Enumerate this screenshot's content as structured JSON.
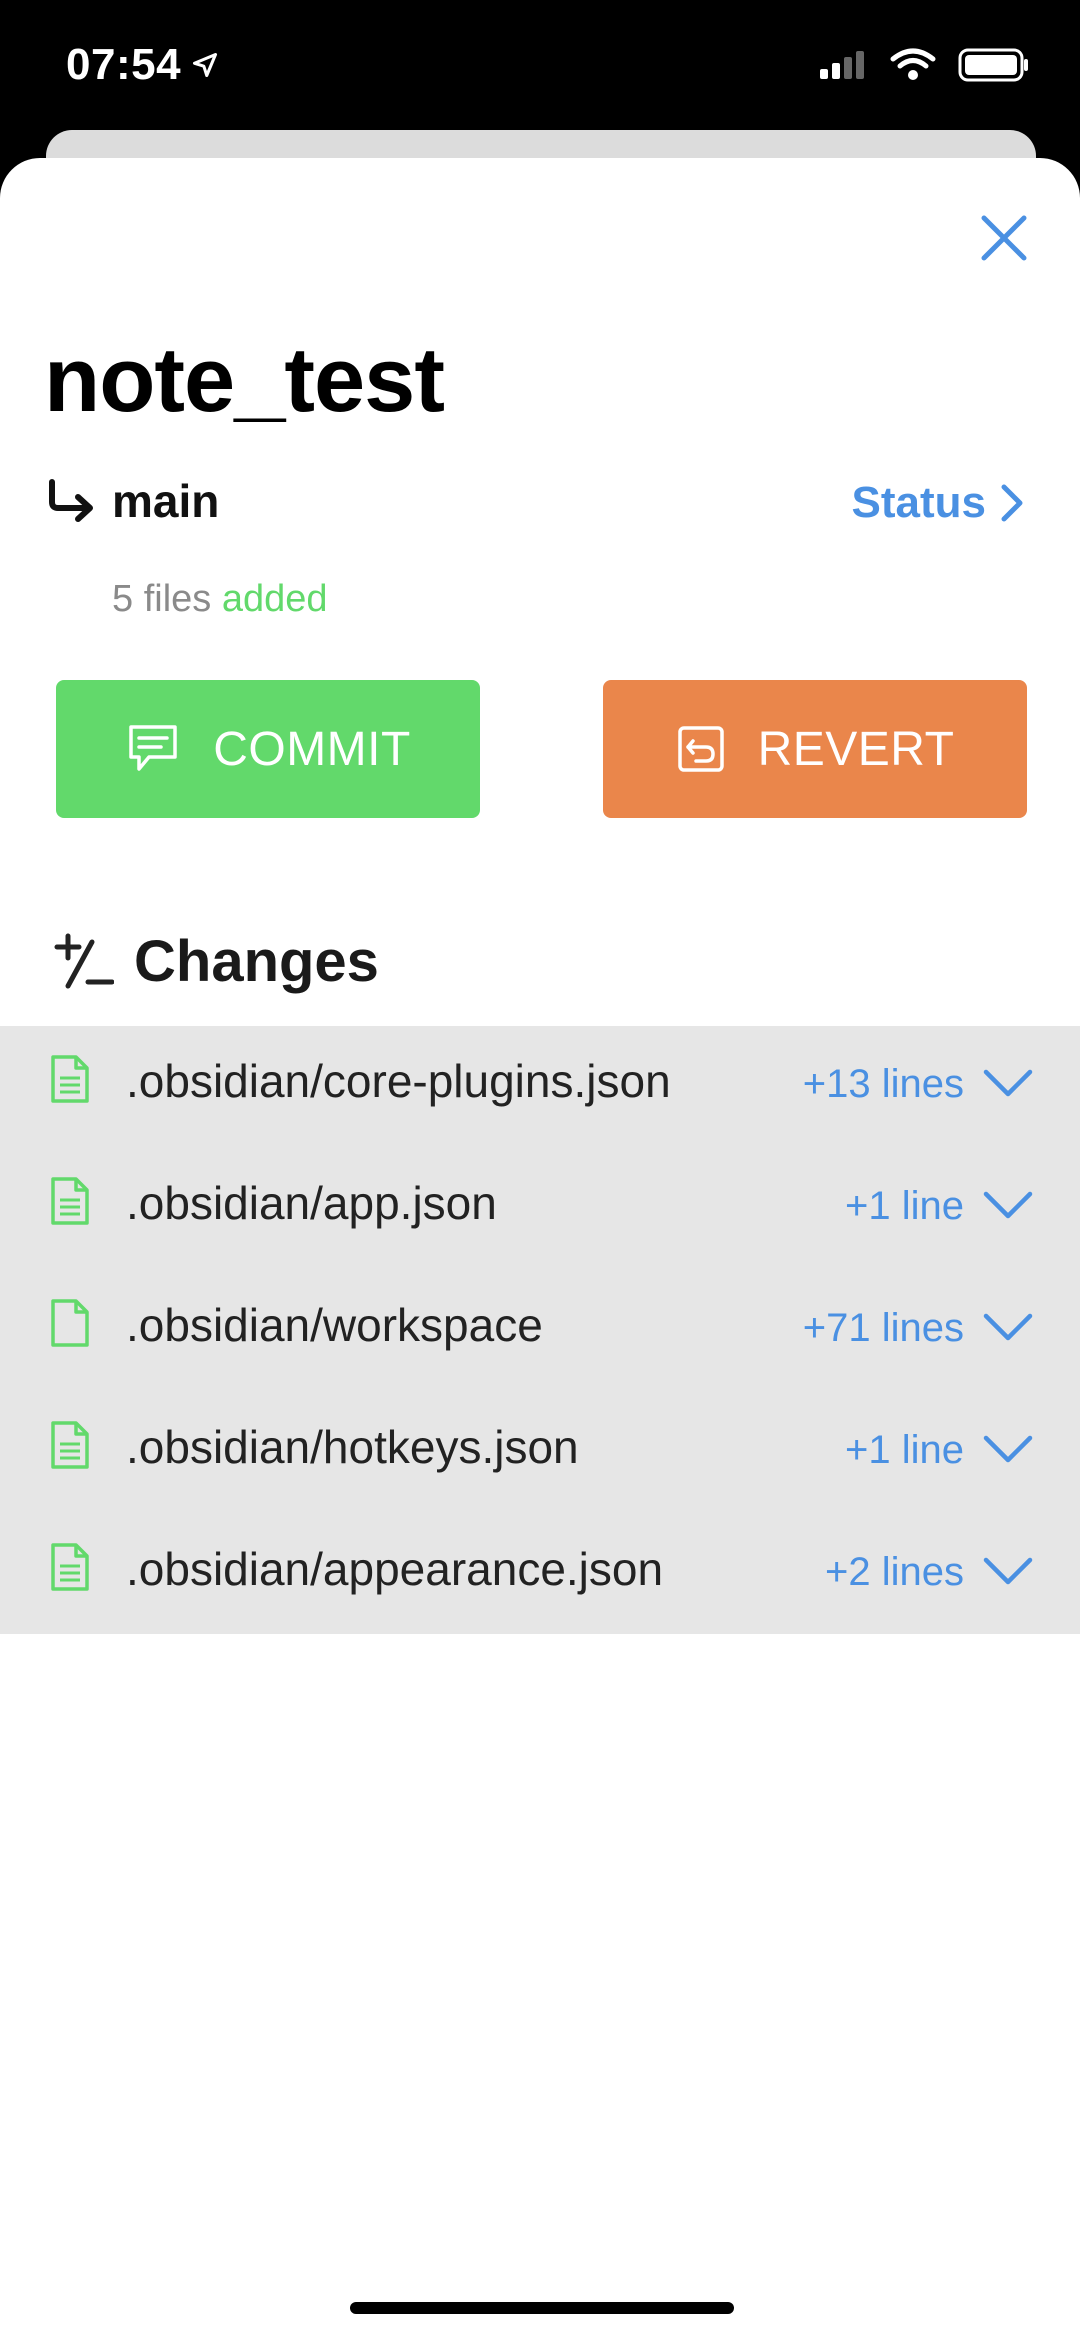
{
  "status_bar": {
    "time": "07:54"
  },
  "repo": {
    "title": "note_test",
    "branch": "main",
    "status_link": "Status"
  },
  "summary": {
    "count_text": "5 files",
    "added_text": "added"
  },
  "actions": {
    "commit_label": "COMMIT",
    "revert_label": "REVERT"
  },
  "changes": {
    "title": "Changes",
    "items": [
      {
        "file": ".obsidian/core-plugins.json",
        "diff": "+13 lines"
      },
      {
        "file": ".obsidian/app.json",
        "diff": "+1 line"
      },
      {
        "file": ".obsidian/workspace",
        "diff": "+71 lines"
      },
      {
        "file": ".obsidian/hotkeys.json",
        "diff": "+1 line"
      },
      {
        "file": ".obsidian/appearance.json",
        "diff": "+2 lines"
      }
    ]
  },
  "colors": {
    "accent": "#4a90e2",
    "commit": "#62d96b",
    "revert": "#ea864b"
  },
  "icons": {
    "close": "close-icon",
    "branch": "branch-arrow-icon",
    "status_chevron": "chevron-right-icon",
    "commit": "message-icon",
    "revert": "revert-icon",
    "changes": "plus-minus-icon",
    "file": "file-icon",
    "expand": "chevron-down-icon"
  }
}
